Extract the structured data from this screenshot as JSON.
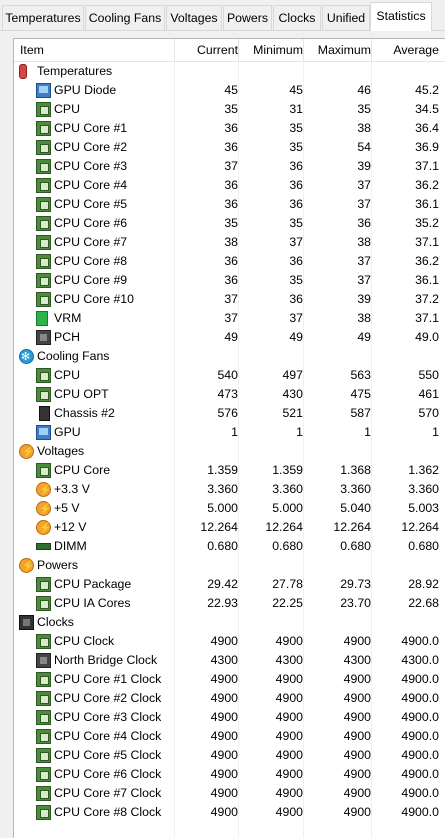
{
  "tabs": [
    "Temperatures",
    "Cooling Fans",
    "Voltages",
    "Powers",
    "Clocks",
    "Unified",
    "Statistics"
  ],
  "active_tab": "Statistics",
  "columns": {
    "item": "Item",
    "current": "Current",
    "minimum": "Minimum",
    "maximum": "Maximum",
    "average": "Average"
  },
  "rows": [
    {
      "type": "group",
      "icon": "thermometer-icon",
      "label": "Temperatures"
    },
    {
      "icon": "gpu-icon",
      "label": "GPU Diode",
      "cur": "45",
      "min": "45",
      "max": "46",
      "avg": "45.2"
    },
    {
      "icon": "chip-icon",
      "label": "CPU",
      "cur": "35",
      "min": "31",
      "max": "35",
      "avg": "34.5"
    },
    {
      "icon": "chip-icon",
      "label": "CPU Core #1",
      "cur": "36",
      "min": "35",
      "max": "38",
      "avg": "36.4"
    },
    {
      "icon": "chip-icon",
      "label": "CPU Core #2",
      "cur": "36",
      "min": "35",
      "max": "54",
      "avg": "36.9"
    },
    {
      "icon": "chip-icon",
      "label": "CPU Core #3",
      "cur": "37",
      "min": "36",
      "max": "39",
      "avg": "37.1"
    },
    {
      "icon": "chip-icon",
      "label": "CPU Core #4",
      "cur": "36",
      "min": "36",
      "max": "37",
      "avg": "36.2"
    },
    {
      "icon": "chip-icon",
      "label": "CPU Core #5",
      "cur": "36",
      "min": "36",
      "max": "37",
      "avg": "36.1"
    },
    {
      "icon": "chip-icon",
      "label": "CPU Core #6",
      "cur": "35",
      "min": "35",
      "max": "36",
      "avg": "35.2"
    },
    {
      "icon": "chip-icon",
      "label": "CPU Core #7",
      "cur": "38",
      "min": "37",
      "max": "38",
      "avg": "37.1"
    },
    {
      "icon": "chip-icon",
      "label": "CPU Core #8",
      "cur": "36",
      "min": "36",
      "max": "37",
      "avg": "36.2"
    },
    {
      "icon": "chip-icon",
      "label": "CPU Core #9",
      "cur": "36",
      "min": "35",
      "max": "37",
      "avg": "36.1"
    },
    {
      "icon": "chip-icon",
      "label": "CPU Core #10",
      "cur": "37",
      "min": "36",
      "max": "39",
      "avg": "37.2"
    },
    {
      "icon": "vrm-icon",
      "label": "VRM",
      "cur": "37",
      "min": "37",
      "max": "38",
      "avg": "37.1"
    },
    {
      "icon": "motherboard-icon",
      "label": "PCH",
      "cur": "49",
      "min": "49",
      "max": "49",
      "avg": "49.0"
    },
    {
      "type": "group",
      "icon": "fan-icon",
      "label": "Cooling Fans"
    },
    {
      "icon": "chip-icon",
      "label": "CPU",
      "cur": "540",
      "min": "497",
      "max": "563",
      "avg": "550"
    },
    {
      "icon": "chip-icon",
      "label": "CPU OPT",
      "cur": "473",
      "min": "430",
      "max": "475",
      "avg": "461"
    },
    {
      "icon": "case-icon",
      "label": "Chassis #2",
      "cur": "576",
      "min": "521",
      "max": "587",
      "avg": "570"
    },
    {
      "icon": "gpu-icon",
      "label": "GPU",
      "cur": "1",
      "min": "1",
      "max": "1",
      "avg": "1"
    },
    {
      "type": "group",
      "icon": "voltage-icon",
      "label": "Voltages"
    },
    {
      "icon": "chip-icon",
      "label": "CPU Core",
      "cur": "1.359",
      "min": "1.359",
      "max": "1.368",
      "avg": "1.362"
    },
    {
      "icon": "voltage-icon",
      "label": "+3.3 V",
      "cur": "3.360",
      "min": "3.360",
      "max": "3.360",
      "avg": "3.360"
    },
    {
      "icon": "voltage-icon",
      "label": "+5 V",
      "cur": "5.000",
      "min": "5.000",
      "max": "5.040",
      "avg": "5.003"
    },
    {
      "icon": "voltage-icon",
      "label": "+12 V",
      "cur": "12.264",
      "min": "12.264",
      "max": "12.264",
      "avg": "12.264"
    },
    {
      "icon": "dimm-icon",
      "label": "DIMM",
      "cur": "0.680",
      "min": "0.680",
      "max": "0.680",
      "avg": "0.680"
    },
    {
      "type": "group",
      "icon": "power-icon",
      "label": "Powers"
    },
    {
      "icon": "chip-icon",
      "label": "CPU Package",
      "cur": "29.42",
      "min": "27.78",
      "max": "29.73",
      "avg": "28.92"
    },
    {
      "icon": "chip-icon",
      "label": "CPU IA Cores",
      "cur": "22.93",
      "min": "22.25",
      "max": "23.70",
      "avg": "22.68"
    },
    {
      "type": "group",
      "icon": "clock-icon",
      "label": "Clocks"
    },
    {
      "icon": "chip-icon",
      "label": "CPU Clock",
      "cur": "4900",
      "min": "4900",
      "max": "4900",
      "avg": "4900.0"
    },
    {
      "icon": "motherboard-icon",
      "label": "North Bridge Clock",
      "cur": "4300",
      "min": "4300",
      "max": "4300",
      "avg": "4300.0"
    },
    {
      "icon": "chip-icon",
      "label": "CPU Core #1 Clock",
      "cur": "4900",
      "min": "4900",
      "max": "4900",
      "avg": "4900.0"
    },
    {
      "icon": "chip-icon",
      "label": "CPU Core #2 Clock",
      "cur": "4900",
      "min": "4900",
      "max": "4900",
      "avg": "4900.0"
    },
    {
      "icon": "chip-icon",
      "label": "CPU Core #3 Clock",
      "cur": "4900",
      "min": "4900",
      "max": "4900",
      "avg": "4900.0"
    },
    {
      "icon": "chip-icon",
      "label": "CPU Core #4 Clock",
      "cur": "4900",
      "min": "4900",
      "max": "4900",
      "avg": "4900.0"
    },
    {
      "icon": "chip-icon",
      "label": "CPU Core #5 Clock",
      "cur": "4900",
      "min": "4900",
      "max": "4900",
      "avg": "4900.0"
    },
    {
      "icon": "chip-icon",
      "label": "CPU Core #6 Clock",
      "cur": "4900",
      "min": "4900",
      "max": "4900",
      "avg": "4900.0"
    },
    {
      "icon": "chip-icon",
      "label": "CPU Core #7 Clock",
      "cur": "4900",
      "min": "4900",
      "max": "4900",
      "avg": "4900.0"
    },
    {
      "icon": "chip-icon",
      "label": "CPU Core #8 Clock",
      "cur": "4900",
      "min": "4900",
      "max": "4900",
      "avg": "4900.0"
    }
  ]
}
